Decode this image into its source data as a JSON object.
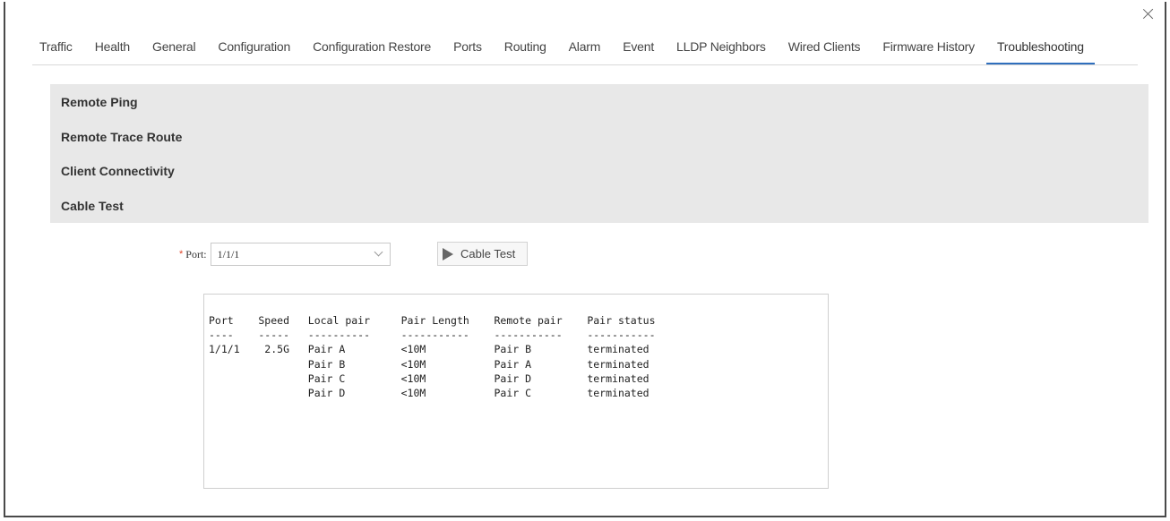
{
  "tabs": [
    {
      "label": "Traffic"
    },
    {
      "label": "Health"
    },
    {
      "label": "General"
    },
    {
      "label": "Configuration"
    },
    {
      "label": "Configuration Restore"
    },
    {
      "label": "Ports"
    },
    {
      "label": "Routing"
    },
    {
      "label": "Alarm"
    },
    {
      "label": "Event"
    },
    {
      "label": "LLDP Neighbors"
    },
    {
      "label": "Wired Clients"
    },
    {
      "label": "Firmware History"
    },
    {
      "label": "Troubleshooting"
    }
  ],
  "active_tab": "Troubleshooting",
  "troubleshooting_menu": [
    {
      "label": "Remote Ping"
    },
    {
      "label": "Remote Trace Route"
    },
    {
      "label": "Client Connectivity"
    },
    {
      "label": "Cable Test"
    }
  ],
  "port_field": {
    "required_marker": "*",
    "label": "Port:",
    "value": "1/1/1"
  },
  "cable_test_button": {
    "label": "Cable Test"
  },
  "result_output": "Port    Speed   Local pair     Pair Length    Remote pair    Pair status\n----    -----   ----------     -----------    -----------    -----------\n1/1/1    2.5G   Pair A         <10M           Pair B         terminated\n                Pair B         <10M           Pair A         terminated\n                Pair C         <10M           Pair D         terminated\n                Pair D         <10M           Pair C         terminated",
  "icons": {
    "close": "close-icon",
    "dropdown": "chevron-down-icon",
    "button": "play-icon"
  },
  "colors": {
    "active_tab_underline": "#2f6fbd",
    "menu_panel_bg": "#e8e8e8",
    "required_marker": "#e0452a"
  }
}
